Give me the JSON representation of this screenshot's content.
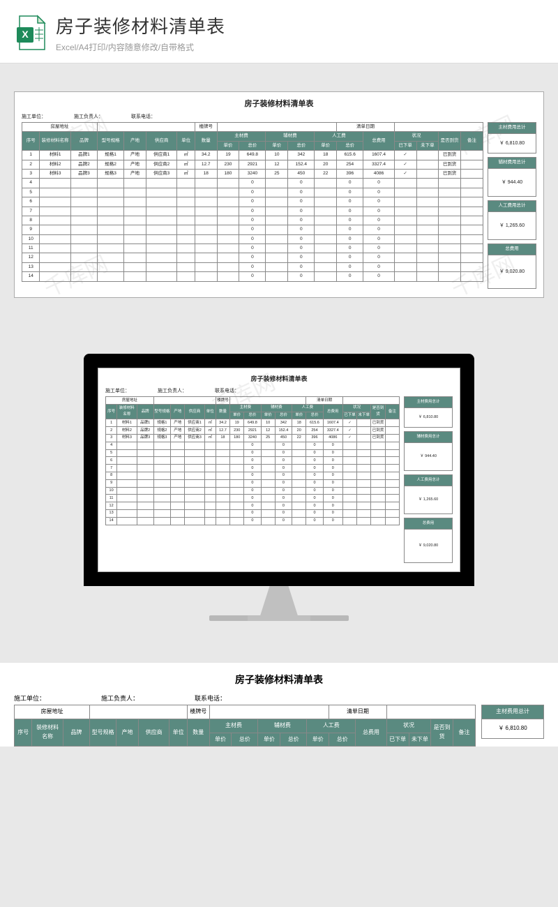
{
  "header": {
    "title": "房子装修材料清单表",
    "subtitle": "Excel/A4打印/内容随意修改/自带格式"
  },
  "sheet": {
    "title": "房子装修材料清单表",
    "info": {
      "construction_unit": "施工单位：",
      "construction_head": "施工负责人：",
      "contact_phone": "联系电话：",
      "house_address": "房屋地址",
      "building_no": "楼牌号",
      "list_date": "清单日期"
    },
    "cols": {
      "seq": "序号",
      "material_name": "装修材料名称",
      "brand": "品牌",
      "model": "型号规格",
      "origin": "产地",
      "supplier": "供应商",
      "unit": "单位",
      "qty": "数量",
      "main_fee": "主材费",
      "aux_fee": "辅材费",
      "labor_fee": "人工费",
      "unit_price": "单价",
      "total_price": "总价",
      "total_cost": "总费用",
      "status": "状况",
      "ordered": "已下单",
      "not_ordered": "未下单",
      "arrived": "是否到货",
      "remark": "备注"
    },
    "rows": [
      {
        "seq": "1",
        "name": "材料1",
        "brand": "品牌1",
        "model": "规格1",
        "origin": "产地",
        "supplier": "供应商1",
        "unit": "㎡",
        "qty": "34.2",
        "mp": "19",
        "mt": "649.8",
        "ap": "10",
        "at": "342",
        "lp": "18",
        "lt": "615.6",
        "total": "1607.4",
        "ordered": "✓",
        "not": "",
        "arrived": "已到货"
      },
      {
        "seq": "2",
        "name": "材料2",
        "brand": "品牌2",
        "model": "规格2",
        "origin": "产地",
        "supplier": "供应商2",
        "unit": "㎡",
        "qty": "12.7",
        "mp": "230",
        "mt": "2921",
        "ap": "12",
        "at": "152.4",
        "lp": "20",
        "lt": "254",
        "total": "3327.4",
        "ordered": "✓",
        "not": "",
        "arrived": "已到货"
      },
      {
        "seq": "3",
        "name": "材料3",
        "brand": "品牌3",
        "model": "规格3",
        "origin": "产地",
        "supplier": "供应商3",
        "unit": "㎡",
        "qty": "18",
        "mp": "180",
        "mt": "3240",
        "ap": "25",
        "at": "450",
        "lp": "22",
        "lt": "396",
        "total": "4086",
        "ordered": "✓",
        "not": "",
        "arrived": "已到货"
      },
      {
        "seq": "4",
        "name": "",
        "brand": "",
        "model": "",
        "origin": "",
        "supplier": "",
        "unit": "",
        "qty": "",
        "mp": "",
        "mt": "0",
        "ap": "",
        "at": "0",
        "lp": "",
        "lt": "0",
        "total": "0",
        "ordered": "",
        "not": "",
        "arrived": ""
      },
      {
        "seq": "5",
        "name": "",
        "brand": "",
        "model": "",
        "origin": "",
        "supplier": "",
        "unit": "",
        "qty": "",
        "mp": "",
        "mt": "0",
        "ap": "",
        "at": "0",
        "lp": "",
        "lt": "0",
        "total": "0",
        "ordered": "",
        "not": "",
        "arrived": ""
      },
      {
        "seq": "6",
        "name": "",
        "brand": "",
        "model": "",
        "origin": "",
        "supplier": "",
        "unit": "",
        "qty": "",
        "mp": "",
        "mt": "0",
        "ap": "",
        "at": "0",
        "lp": "",
        "lt": "0",
        "total": "0",
        "ordered": "",
        "not": "",
        "arrived": ""
      },
      {
        "seq": "7",
        "name": "",
        "brand": "",
        "model": "",
        "origin": "",
        "supplier": "",
        "unit": "",
        "qty": "",
        "mp": "",
        "mt": "0",
        "ap": "",
        "at": "0",
        "lp": "",
        "lt": "0",
        "total": "0",
        "ordered": "",
        "not": "",
        "arrived": ""
      },
      {
        "seq": "8",
        "name": "",
        "brand": "",
        "model": "",
        "origin": "",
        "supplier": "",
        "unit": "",
        "qty": "",
        "mp": "",
        "mt": "0",
        "ap": "",
        "at": "0",
        "lp": "",
        "lt": "0",
        "total": "0",
        "ordered": "",
        "not": "",
        "arrived": ""
      },
      {
        "seq": "9",
        "name": "",
        "brand": "",
        "model": "",
        "origin": "",
        "supplier": "",
        "unit": "",
        "qty": "",
        "mp": "",
        "mt": "0",
        "ap": "",
        "at": "0",
        "lp": "",
        "lt": "0",
        "total": "0",
        "ordered": "",
        "not": "",
        "arrived": ""
      },
      {
        "seq": "10",
        "name": "",
        "brand": "",
        "model": "",
        "origin": "",
        "supplier": "",
        "unit": "",
        "qty": "",
        "mp": "",
        "mt": "0",
        "ap": "",
        "at": "0",
        "lp": "",
        "lt": "0",
        "total": "0",
        "ordered": "",
        "not": "",
        "arrived": ""
      },
      {
        "seq": "11",
        "name": "",
        "brand": "",
        "model": "",
        "origin": "",
        "supplier": "",
        "unit": "",
        "qty": "",
        "mp": "",
        "mt": "0",
        "ap": "",
        "at": "0",
        "lp": "",
        "lt": "0",
        "total": "0",
        "ordered": "",
        "not": "",
        "arrived": ""
      },
      {
        "seq": "12",
        "name": "",
        "brand": "",
        "model": "",
        "origin": "",
        "supplier": "",
        "unit": "",
        "qty": "",
        "mp": "",
        "mt": "0",
        "ap": "",
        "at": "0",
        "lp": "",
        "lt": "0",
        "total": "0",
        "ordered": "",
        "not": "",
        "arrived": ""
      },
      {
        "seq": "13",
        "name": "",
        "brand": "",
        "model": "",
        "origin": "",
        "supplier": "",
        "unit": "",
        "qty": "",
        "mp": "",
        "mt": "0",
        "ap": "",
        "at": "0",
        "lp": "",
        "lt": "0",
        "total": "0",
        "ordered": "",
        "not": "",
        "arrived": ""
      },
      {
        "seq": "14",
        "name": "",
        "brand": "",
        "model": "",
        "origin": "",
        "supplier": "",
        "unit": "",
        "qty": "",
        "mp": "",
        "mt": "0",
        "ap": "",
        "at": "0",
        "lp": "",
        "lt": "0",
        "total": "0",
        "ordered": "",
        "not": "",
        "arrived": ""
      }
    ],
    "summary": {
      "main_label": "主材费用总计",
      "main_val": "￥  6,810.80",
      "aux_label": "辅材费用总计",
      "aux_val": "￥    944.40",
      "labor_label": "人工费用总计",
      "labor_val": "￥  1,265.60",
      "total_label": "总费用",
      "total_val": "￥  9,020.80"
    }
  },
  "watermark": "千库网"
}
